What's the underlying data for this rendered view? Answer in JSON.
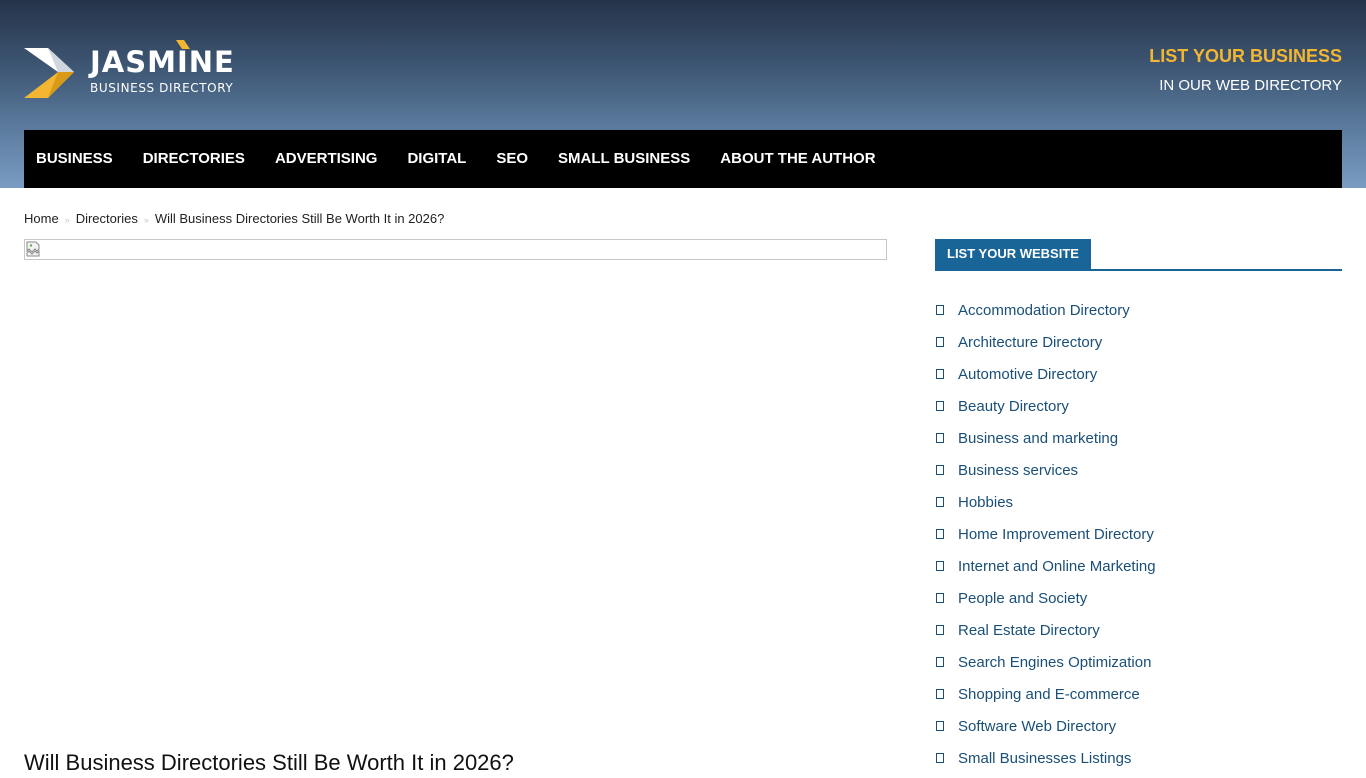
{
  "site": {
    "logo_name": "JASMINE",
    "logo_tagline": "BUSINESS DIRECTORY",
    "accent_color": "#f2b632",
    "header_cta_main": "LIST YOUR BUSINESS",
    "header_cta_sub": "IN OUR WEB DIRECTORY"
  },
  "nav": {
    "items": [
      {
        "label": "BUSINESS"
      },
      {
        "label": "DIRECTORIES"
      },
      {
        "label": "ADVERTISING"
      },
      {
        "label": "DIGITAL"
      },
      {
        "label": "SEO"
      },
      {
        "label": "SMALL BUSINESS"
      },
      {
        "label": "ABOUT THE AUTHOR"
      }
    ]
  },
  "breadcrumb": {
    "home": "Home",
    "category": "Directories",
    "current": "Will Business Directories Still Be Worth It in 2026?",
    "separator": "»"
  },
  "post": {
    "image_icon": "broken-image-icon",
    "title": "Will Business Directories Still Be Worth It in 2026?"
  },
  "sidebar": {
    "widget_title": "LIST YOUR WEBSITE",
    "widget_color": "#1a6597",
    "items": [
      {
        "label": "Accommodation Directory"
      },
      {
        "label": "Architecture Directory"
      },
      {
        "label": "Automotive Directory"
      },
      {
        "label": "Beauty Directory"
      },
      {
        "label": "Business and marketing"
      },
      {
        "label": "Business services"
      },
      {
        "label": "Hobbies"
      },
      {
        "label": "Home Improvement Directory"
      },
      {
        "label": "Internet and Online Marketing"
      },
      {
        "label": "People and Society"
      },
      {
        "label": "Real Estate Directory"
      },
      {
        "label": "Search Engines Optimization"
      },
      {
        "label": "Shopping and E-commerce"
      },
      {
        "label": "Software Web Directory"
      },
      {
        "label": "Small Businesses Listings"
      }
    ]
  }
}
